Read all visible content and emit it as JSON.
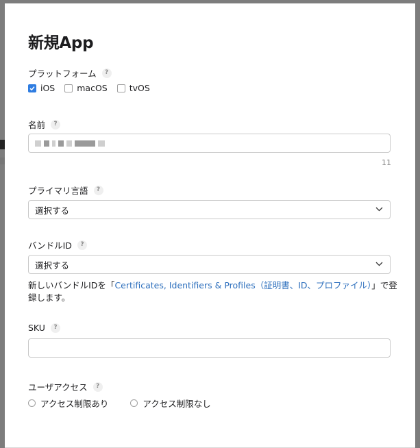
{
  "dialog": {
    "title": "新規App"
  },
  "platform": {
    "label": "プラットフォーム",
    "help": "?",
    "options": [
      {
        "label": "iOS",
        "checked": true
      },
      {
        "label": "macOS",
        "checked": false
      },
      {
        "label": "tvOS",
        "checked": false
      }
    ]
  },
  "name": {
    "label": "名前",
    "help": "?",
    "char_count": "11"
  },
  "primary_language": {
    "label": "プライマリ言語",
    "help": "?",
    "selected": "選択する"
  },
  "bundle_id": {
    "label": "バンドルID",
    "help": "?",
    "selected": "選択する",
    "note_prefix": "新しいバンドルIDを「",
    "note_link": "Certificates, Identifiers & Profiles（証明書、ID、プロファイル）",
    "note_suffix": "」で登録します。"
  },
  "sku": {
    "label": "SKU",
    "help": "?",
    "value": ""
  },
  "user_access": {
    "label": "ユーザアクセス",
    "help": "?",
    "options": [
      {
        "label": "アクセス制限あり"
      },
      {
        "label": "アクセス制限なし"
      }
    ]
  },
  "colors": {
    "accent": "#2f7de1",
    "link": "#2d6fbd"
  }
}
